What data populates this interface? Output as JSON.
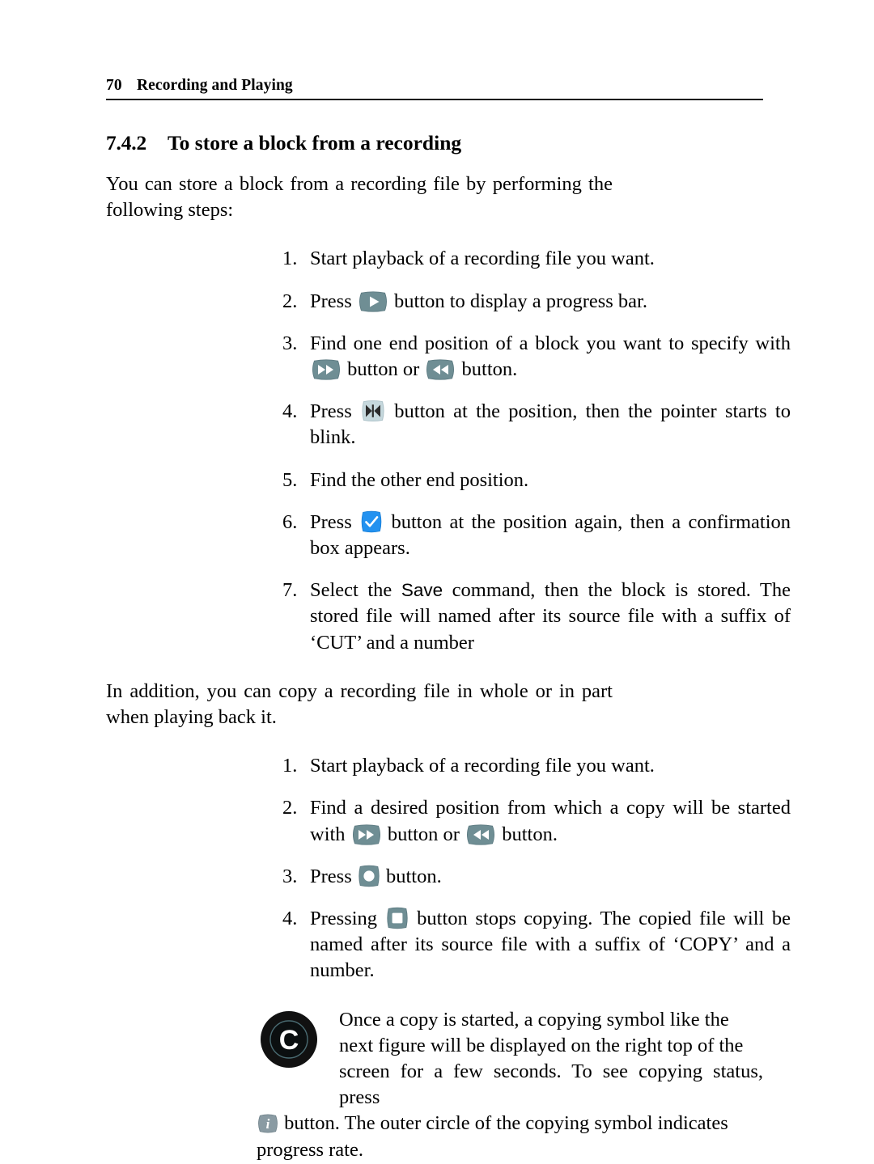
{
  "page": {
    "number": "70",
    "running_title": "Recording and Playing"
  },
  "section": {
    "number": "7.4.2",
    "title": "To store a block from a recording"
  },
  "intro": {
    "text": "You can store a block from a recording file by performing the following steps:"
  },
  "steps_store": [
    {
      "num": "1.",
      "parts": [
        {
          "type": "text",
          "value": "Start playback of a recording file you want."
        }
      ]
    },
    {
      "num": "2.",
      "parts": [
        {
          "type": "text",
          "value": "Press "
        },
        {
          "type": "icon",
          "value": "play-button-icon"
        },
        {
          "type": "text",
          "value": " button to display a progress bar."
        }
      ]
    },
    {
      "num": "3.",
      "parts": [
        {
          "type": "text",
          "value": "Find one end position of a block you want to specify with "
        },
        {
          "type": "icon",
          "value": "fast-forward-button-icon"
        },
        {
          "type": "text",
          "value": " button or "
        },
        {
          "type": "icon",
          "value": "rewind-button-icon"
        },
        {
          "type": "text",
          "value": " button."
        }
      ]
    },
    {
      "num": "4.",
      "parts": [
        {
          "type": "text",
          "value": "Press "
        },
        {
          "type": "icon",
          "value": "mark-button-icon"
        },
        {
          "type": "text",
          "value": " button at the position, then the pointer starts to blink."
        }
      ]
    },
    {
      "num": "5.",
      "parts": [
        {
          "type": "text",
          "value": "Find the other end position."
        }
      ]
    },
    {
      "num": "6.",
      "parts": [
        {
          "type": "text",
          "value": "Press "
        },
        {
          "type": "icon",
          "value": "confirm-check-button-icon"
        },
        {
          "type": "text",
          "value": " button at the position again, then a confirmation box appears."
        }
      ]
    },
    {
      "num": "7.",
      "parts": [
        {
          "type": "text",
          "value": "Select the "
        },
        {
          "type": "sans",
          "value": "Save"
        },
        {
          "type": "text",
          "value": " command, then the block is stored. The stored file will named after its source file with a suffix of ‘CUT’ and a number"
        }
      ]
    }
  ],
  "copy_intro": {
    "text": "In addition, you can copy a recording file in whole or in part when playing back it."
  },
  "steps_copy": [
    {
      "num": "1.",
      "parts": [
        {
          "type": "text",
          "value": "Start playback of a recording file you want."
        }
      ]
    },
    {
      "num": "2.",
      "parts": [
        {
          "type": "text",
          "value": "Find a desired position from which a copy will be started with "
        },
        {
          "type": "icon",
          "value": "fast-forward-button-icon"
        },
        {
          "type": "text",
          "value": " button or "
        },
        {
          "type": "icon",
          "value": "rewind-button-icon"
        },
        {
          "type": "text",
          "value": " button."
        }
      ]
    },
    {
      "num": "3.",
      "parts": [
        {
          "type": "text",
          "value": "Press "
        },
        {
          "type": "icon",
          "value": "record-button-icon"
        },
        {
          "type": "text",
          "value": " button."
        }
      ]
    },
    {
      "num": "4.",
      "parts": [
        {
          "type": "text",
          "value": "Pressing "
        },
        {
          "type": "icon",
          "value": "stop-button-icon"
        },
        {
          "type": "text",
          "value": " button stops copying. The copied file will be named after its source file with a suffix of ‘COPY’ and a number."
        }
      ]
    }
  ],
  "note": {
    "badge_icon": "copying-symbol-icon",
    "badge_letter": "C",
    "line1": "Once a copy is started, a copying symbol like the",
    "line2": "next figure will be displayed on the right top of the",
    "line3": "screen for a few seconds. To see copying status, press",
    "info_icon": "info-button-icon",
    "line4": " button. The outer circle of the copying symbol indicates",
    "line5": "progress rate."
  },
  "colors": {
    "teal_button": "#6f8e94",
    "teal_button_dark": "#5d7b82",
    "blue_button": "#2392f0",
    "light_button": "#c6d8dd",
    "info_button": "#8a9ba3",
    "badge_black": "#111111",
    "text": "#000000",
    "rule": "#1a1a1a",
    "page_background": "#ffffff"
  }
}
